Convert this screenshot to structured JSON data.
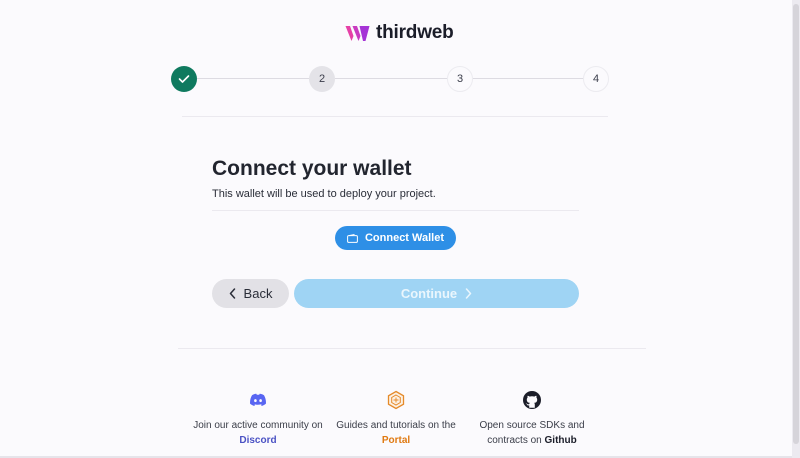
{
  "brand": {
    "name": "thirdweb",
    "colors": {
      "mark_pink": "#e640a7",
      "mark_purple": "#a533d6"
    }
  },
  "stepper": {
    "steps": [
      {
        "label": "",
        "state": "done",
        "icon": "check-icon"
      },
      {
        "label": "2",
        "state": "current"
      },
      {
        "label": "3",
        "state": "todo"
      },
      {
        "label": "4",
        "state": "todo"
      }
    ]
  },
  "main": {
    "title": "Connect your wallet",
    "subtitle": "This wallet will be used to deploy your project.",
    "connect_button": {
      "label": "Connect Wallet",
      "icon": "wallet-icon"
    },
    "back_button": {
      "label": "Back",
      "icon": "chevron-left-icon"
    },
    "continue_button": {
      "label": "Continue",
      "icon": "chevron-right-icon",
      "disabled": true
    }
  },
  "footer": {
    "discord": {
      "text_before": "Join our active community on",
      "link": "Discord",
      "icon": "discord-icon"
    },
    "portal": {
      "text_before": "Guides and tutorials on the",
      "link": "Portal",
      "icon": "portal-icon"
    },
    "github": {
      "text_before": "Open source SDKs and contracts on",
      "link": "Github",
      "icon": "github-icon"
    }
  },
  "colors": {
    "accent": "#2e8fe6",
    "done_step": "#0f7a5f",
    "continue_disabled": "#9fd4f4"
  }
}
